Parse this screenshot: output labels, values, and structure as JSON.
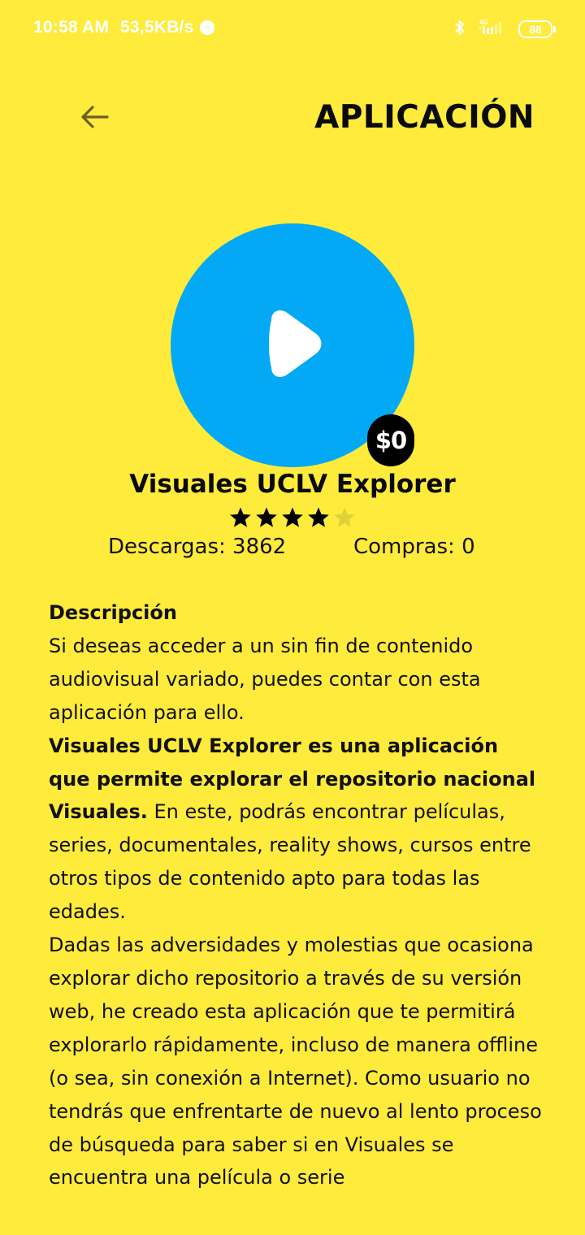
{
  "status_bar": {
    "time": "10:58 AM",
    "speed": "53,5KB/s",
    "network": "4G",
    "battery": "88"
  },
  "header": {
    "title": "APLICACIÓN"
  },
  "app": {
    "name": "Visuales UCLV Explorer",
    "price": "$0",
    "icon_color": "#03A9F4",
    "rating": 4,
    "rating_max": 5,
    "downloads_label": "Descargas: 3862",
    "purchases_label": "Compras: 0"
  },
  "description": {
    "heading": "Descripción",
    "p1": "Si deseas acceder a un sin fin de contenido audiovisual variado, puedes contar con esta aplicación para ello.",
    "p2_bold": "Visuales UCLV Explorer es una aplicación que permite explorar el repositorio nacional Visuales.",
    "p2_rest": " En este, podrás encontrar películas, series, documentales, reality shows, cursos entre otros tipos de contenido apto para todas las edades.",
    "p3": "Dadas las adversidades y molestias que ocasiona explorar dicho repositorio a través de su versión web, he creado esta aplicación que te permitirá explorarlo rápidamente, incluso de manera offline (o sea, sin conexión a Internet). Como usuario no tendrás que enfrentarte de nuevo al lento proceso de búsqueda para saber si en Visuales se encuentra una película o serie"
  },
  "colors": {
    "background": "#FFEB3B",
    "accent": "#03A9F4",
    "text": "#111111"
  }
}
